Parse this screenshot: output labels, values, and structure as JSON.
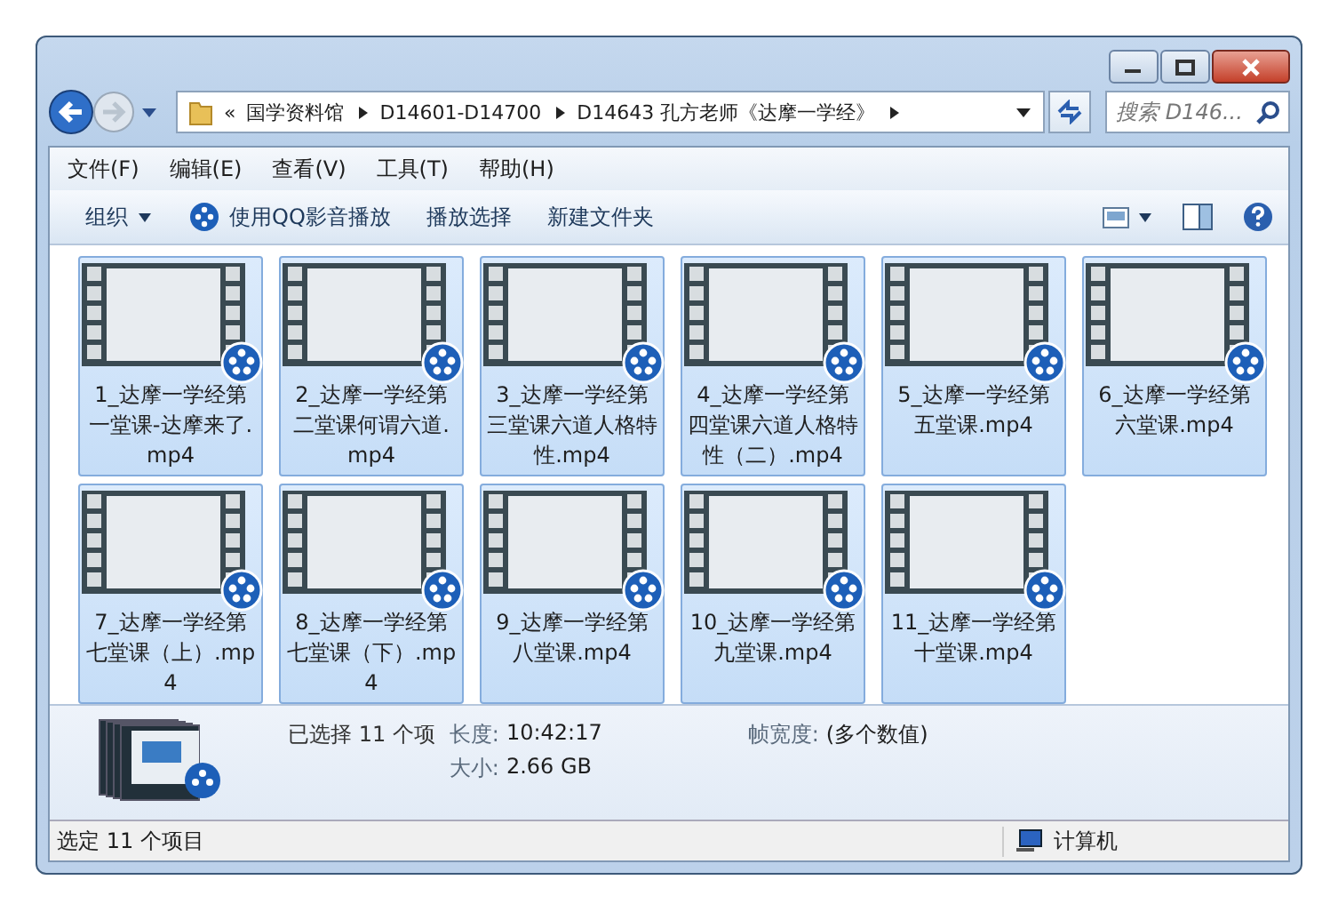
{
  "address": {
    "overflow": "«",
    "crumbs": [
      "国学资料馆",
      "D14601-D14700",
      "D14643 孔方老师《达摩一学经》"
    ]
  },
  "search": {
    "placeholder": "搜索 D146..."
  },
  "menu": [
    "文件(F)",
    "编辑(E)",
    "查看(V)",
    "工具(T)",
    "帮助(H)"
  ],
  "toolbar": [
    {
      "label": "组织",
      "kind": "dropdown"
    },
    {
      "label": "使用QQ影音播放",
      "kind": "player"
    },
    {
      "label": "播放选择",
      "kind": "plain"
    },
    {
      "label": "新建文件夹",
      "kind": "plain"
    }
  ],
  "files": [
    {
      "name": "1_达摩一学经第一堂课-达摩来了.mp4",
      "selected": true
    },
    {
      "name": "2_达摩一学经第二堂课何谓六道.mp4",
      "selected": true
    },
    {
      "name": "3_达摩一学经第三堂课六道人格特性.mp4",
      "selected": true
    },
    {
      "name": "4_达摩一学经第四堂课六道人格特性（二）.mp4",
      "selected": true
    },
    {
      "name": "5_达摩一学经第五堂课.mp4",
      "selected": true
    },
    {
      "name": "6_达摩一学经第六堂课.mp4",
      "selected": true
    },
    {
      "name": "7_达摩一学经第七堂课（上）.mp4",
      "selected": true
    },
    {
      "name": "8_达摩一学经第七堂课（下）.mp4",
      "selected": true
    },
    {
      "name": "9_达摩一学经第八堂课.mp4",
      "selected": true
    },
    {
      "name": "10_达摩一学经第九堂课.mp4",
      "selected": true
    },
    {
      "name": "11_达摩一学经第十堂课.mp4",
      "selected": true
    }
  ],
  "details": {
    "summary": "已选择 11 个项",
    "columns": [
      [
        {
          "label": "长度:",
          "value": "10:42:17"
        },
        {
          "label": "大小:",
          "value": "2.66 GB"
        }
      ],
      [
        {
          "label": "帧宽度:",
          "value": "(多个数值)"
        }
      ]
    ]
  },
  "status_bar": {
    "text": "选定 11 个项目",
    "location": "计算机"
  }
}
